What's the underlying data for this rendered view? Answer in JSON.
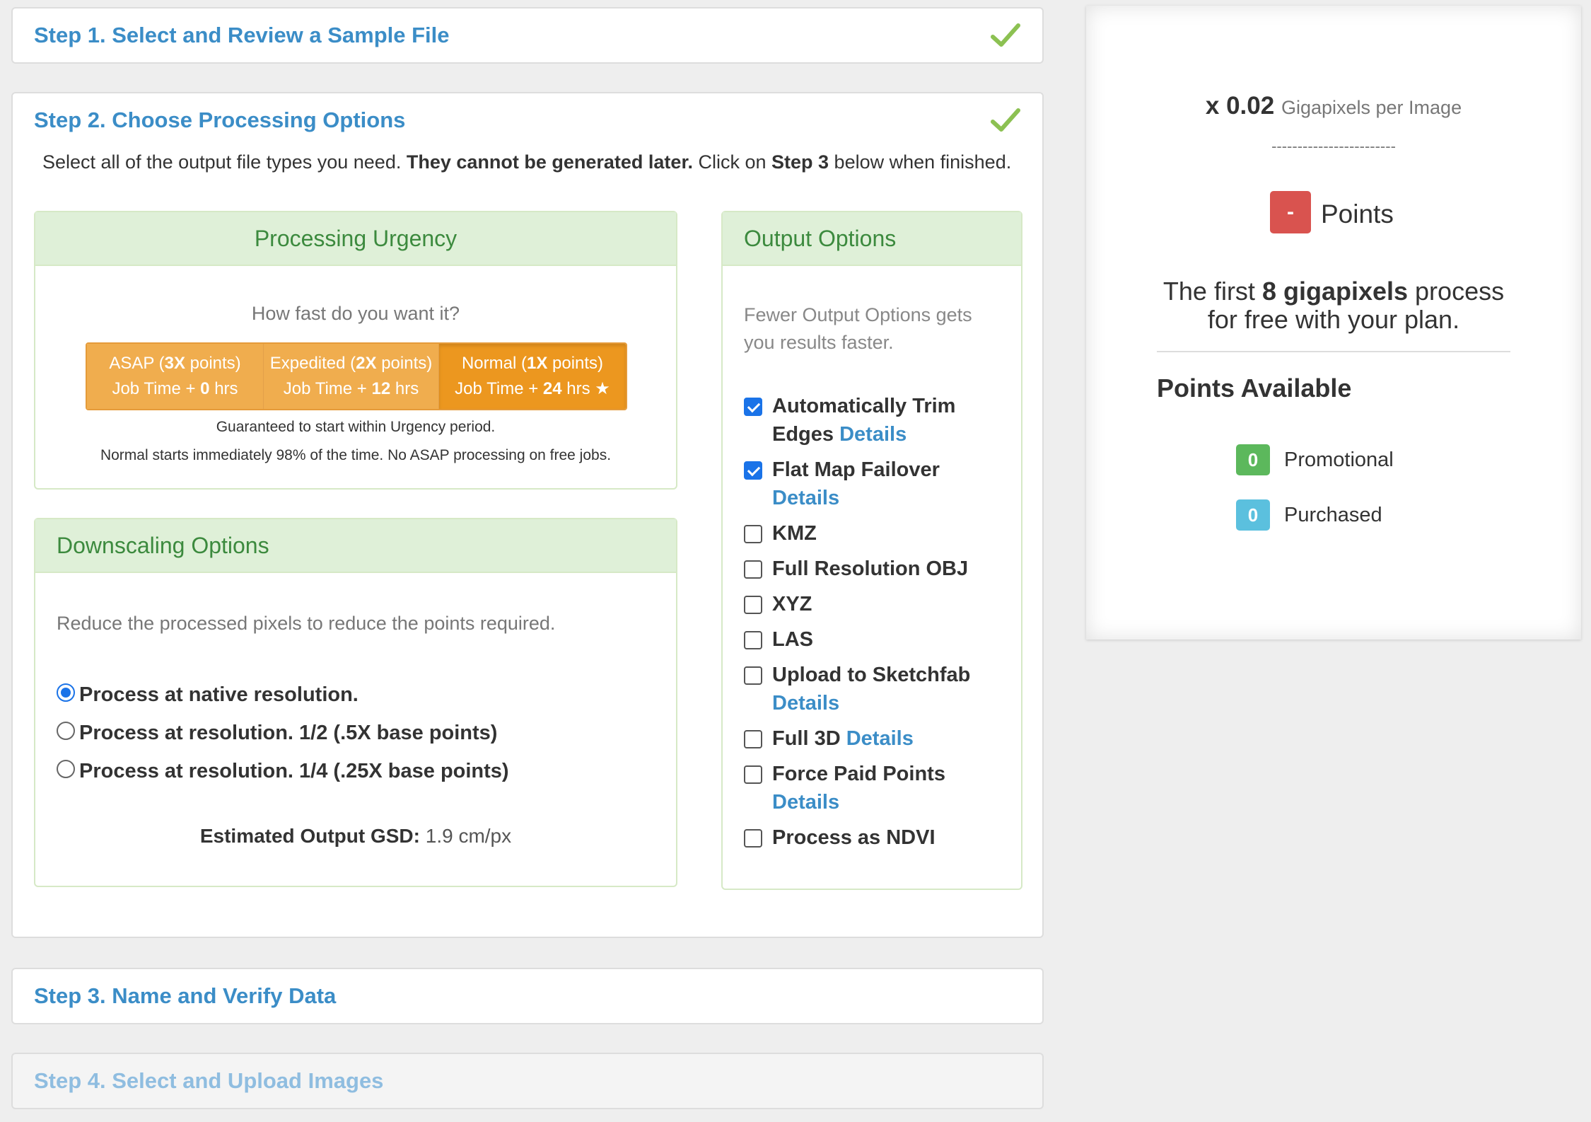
{
  "step1": {
    "title": "Step 1. Select and Review a Sample File"
  },
  "step2": {
    "title": "Step 2. Choose Processing Options",
    "instructions": {
      "part1": "Select all of the output file types you need. ",
      "bold1": "They cannot be generated later.",
      "part2": " Click on ",
      "bold2": "Step 3",
      "part3": " below when finished."
    }
  },
  "urgency": {
    "title": "Processing Urgency",
    "question": "How fast do you want it?",
    "options": [
      {
        "name": "ASAP",
        "mult": "3X",
        "points": "points",
        "job": "Job Time + ",
        "hrs_val": "0",
        "hrs": "hrs",
        "star": ""
      },
      {
        "name": "Expedited",
        "mult": "2X",
        "points": "points",
        "job": "Job Time + ",
        "hrs_val": "12",
        "hrs": "hrs",
        "star": ""
      },
      {
        "name": "Normal",
        "mult": "1X",
        "points": "points",
        "job": "Job Time + ",
        "hrs_val": "24",
        "hrs": "hrs",
        "star": "★"
      }
    ],
    "selected": "Normal",
    "note1": "Guaranteed to start within Urgency period.",
    "note2": "Normal starts immediately 98% of the time. No ASAP processing on free jobs."
  },
  "downscaling": {
    "title": "Downscaling Options",
    "desc": "Reduce the processed pixels to reduce the points required.",
    "options": [
      {
        "label": "Process at native resolution.",
        "selected": true
      },
      {
        "label": "Process at resolution. 1/2 (.5X base points)",
        "selected": false
      },
      {
        "label": "Process at resolution. 1/4 (.25X base points)",
        "selected": false
      }
    ],
    "gsd_label": "Estimated Output GSD:",
    "gsd_value": "1.9 cm/px"
  },
  "output": {
    "title": "Output Options",
    "desc_line1": "Fewer Output Options gets",
    "desc_line2": "you results faster.",
    "details_label": "Details",
    "items": [
      {
        "line1": "Automatically Trim",
        "line2": "Edges",
        "checked": true
      },
      {
        "line1": "Flat Map Failover",
        "line2": "",
        "checked": true
      },
      {
        "line1": "KMZ",
        "line2": "",
        "checked": false
      },
      {
        "line1": "Full Resolution OBJ",
        "line2": "",
        "checked": false
      },
      {
        "line1": "XYZ",
        "line2": "",
        "checked": false
      },
      {
        "line1": "LAS",
        "line2": "",
        "checked": false
      },
      {
        "line1": "Upload to Sketchfab",
        "line2": "",
        "checked": false
      },
      {
        "line1": "Full 3D",
        "line2": "",
        "checked": false
      },
      {
        "line1": "Force Paid Points",
        "line2": "",
        "checked": false
      },
      {
        "line1": "Process as NDVI",
        "line2": "",
        "checked": false
      }
    ]
  },
  "step3": {
    "title": "Step 3. Name and Verify Data"
  },
  "step4": {
    "title": "Step 4. Select and Upload Images"
  },
  "summary": {
    "multiplier_prefix": "x ",
    "multiplier_value": "0.02",
    "multiplier_unit": "Gigapixels per Image",
    "divider": "------------------------",
    "points_badge": "-",
    "points_label": "Points",
    "free_line1_a": "The first ",
    "free_line1_b": "8 gigapixels",
    "free_line1_c": " process",
    "free_line2": "for free with your plan.",
    "available_title": "Points Available",
    "promotional_value": "0",
    "promotional_label": "Promotional",
    "purchased_value": "0",
    "purchased_label": "Purchased"
  },
  "colors": {
    "link": "#3b8dc7",
    "urgency": "#f0ad4e",
    "urgency_active": "#ec971f",
    "danger": "#d9534f",
    "success": "#5cb85c",
    "info": "#5bc0de",
    "panel_head": "#dff0d8"
  }
}
